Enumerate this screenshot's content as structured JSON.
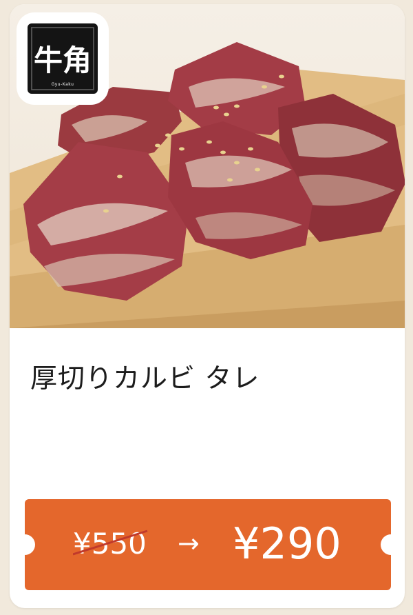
{
  "brand": {
    "logo_text": "牛角",
    "logo_subtext": "Gyu-Kaku"
  },
  "item": {
    "title": "厚切りカルビ タレ",
    "image_icon": "grilled-beef-photo"
  },
  "coupon": {
    "original_price": "¥550",
    "arrow": "→",
    "discount_price": "¥290",
    "color": "#e4672c"
  }
}
